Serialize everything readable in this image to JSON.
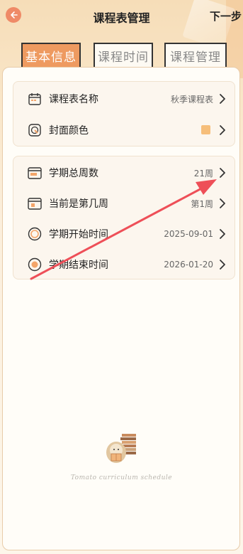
{
  "header": {
    "title": "课程表管理",
    "next_label": "下一步"
  },
  "tabs": [
    {
      "label": "基本信息",
      "active": true
    },
    {
      "label": "课程时间",
      "active": false
    },
    {
      "label": "课程管理",
      "active": false
    }
  ],
  "group1": [
    {
      "label": "课程表名称",
      "value": "秋季课程表",
      "icon": "calendar-icon"
    },
    {
      "label": "封面颜色",
      "value": "",
      "icon": "palette-icon",
      "swatch_color": "#f6be7a"
    }
  ],
  "group2": [
    {
      "label": "学期总周数",
      "value": "21周",
      "icon": "calendar-weeks-icon"
    },
    {
      "label": "当前是第几周",
      "value": "第1周",
      "icon": "calendar-current-icon"
    },
    {
      "label": "学期开始时间",
      "value": "2025-09-01",
      "icon": "clock-start-icon"
    },
    {
      "label": "学期结束时间",
      "value": "2026-01-20",
      "icon": "clock-end-icon"
    }
  ],
  "footer": {
    "text": "Tomato curriculum schedule"
  },
  "colors": {
    "accent": "#ee9a60",
    "arrow": "#ee4f58",
    "back_button": "#ef8a67"
  }
}
